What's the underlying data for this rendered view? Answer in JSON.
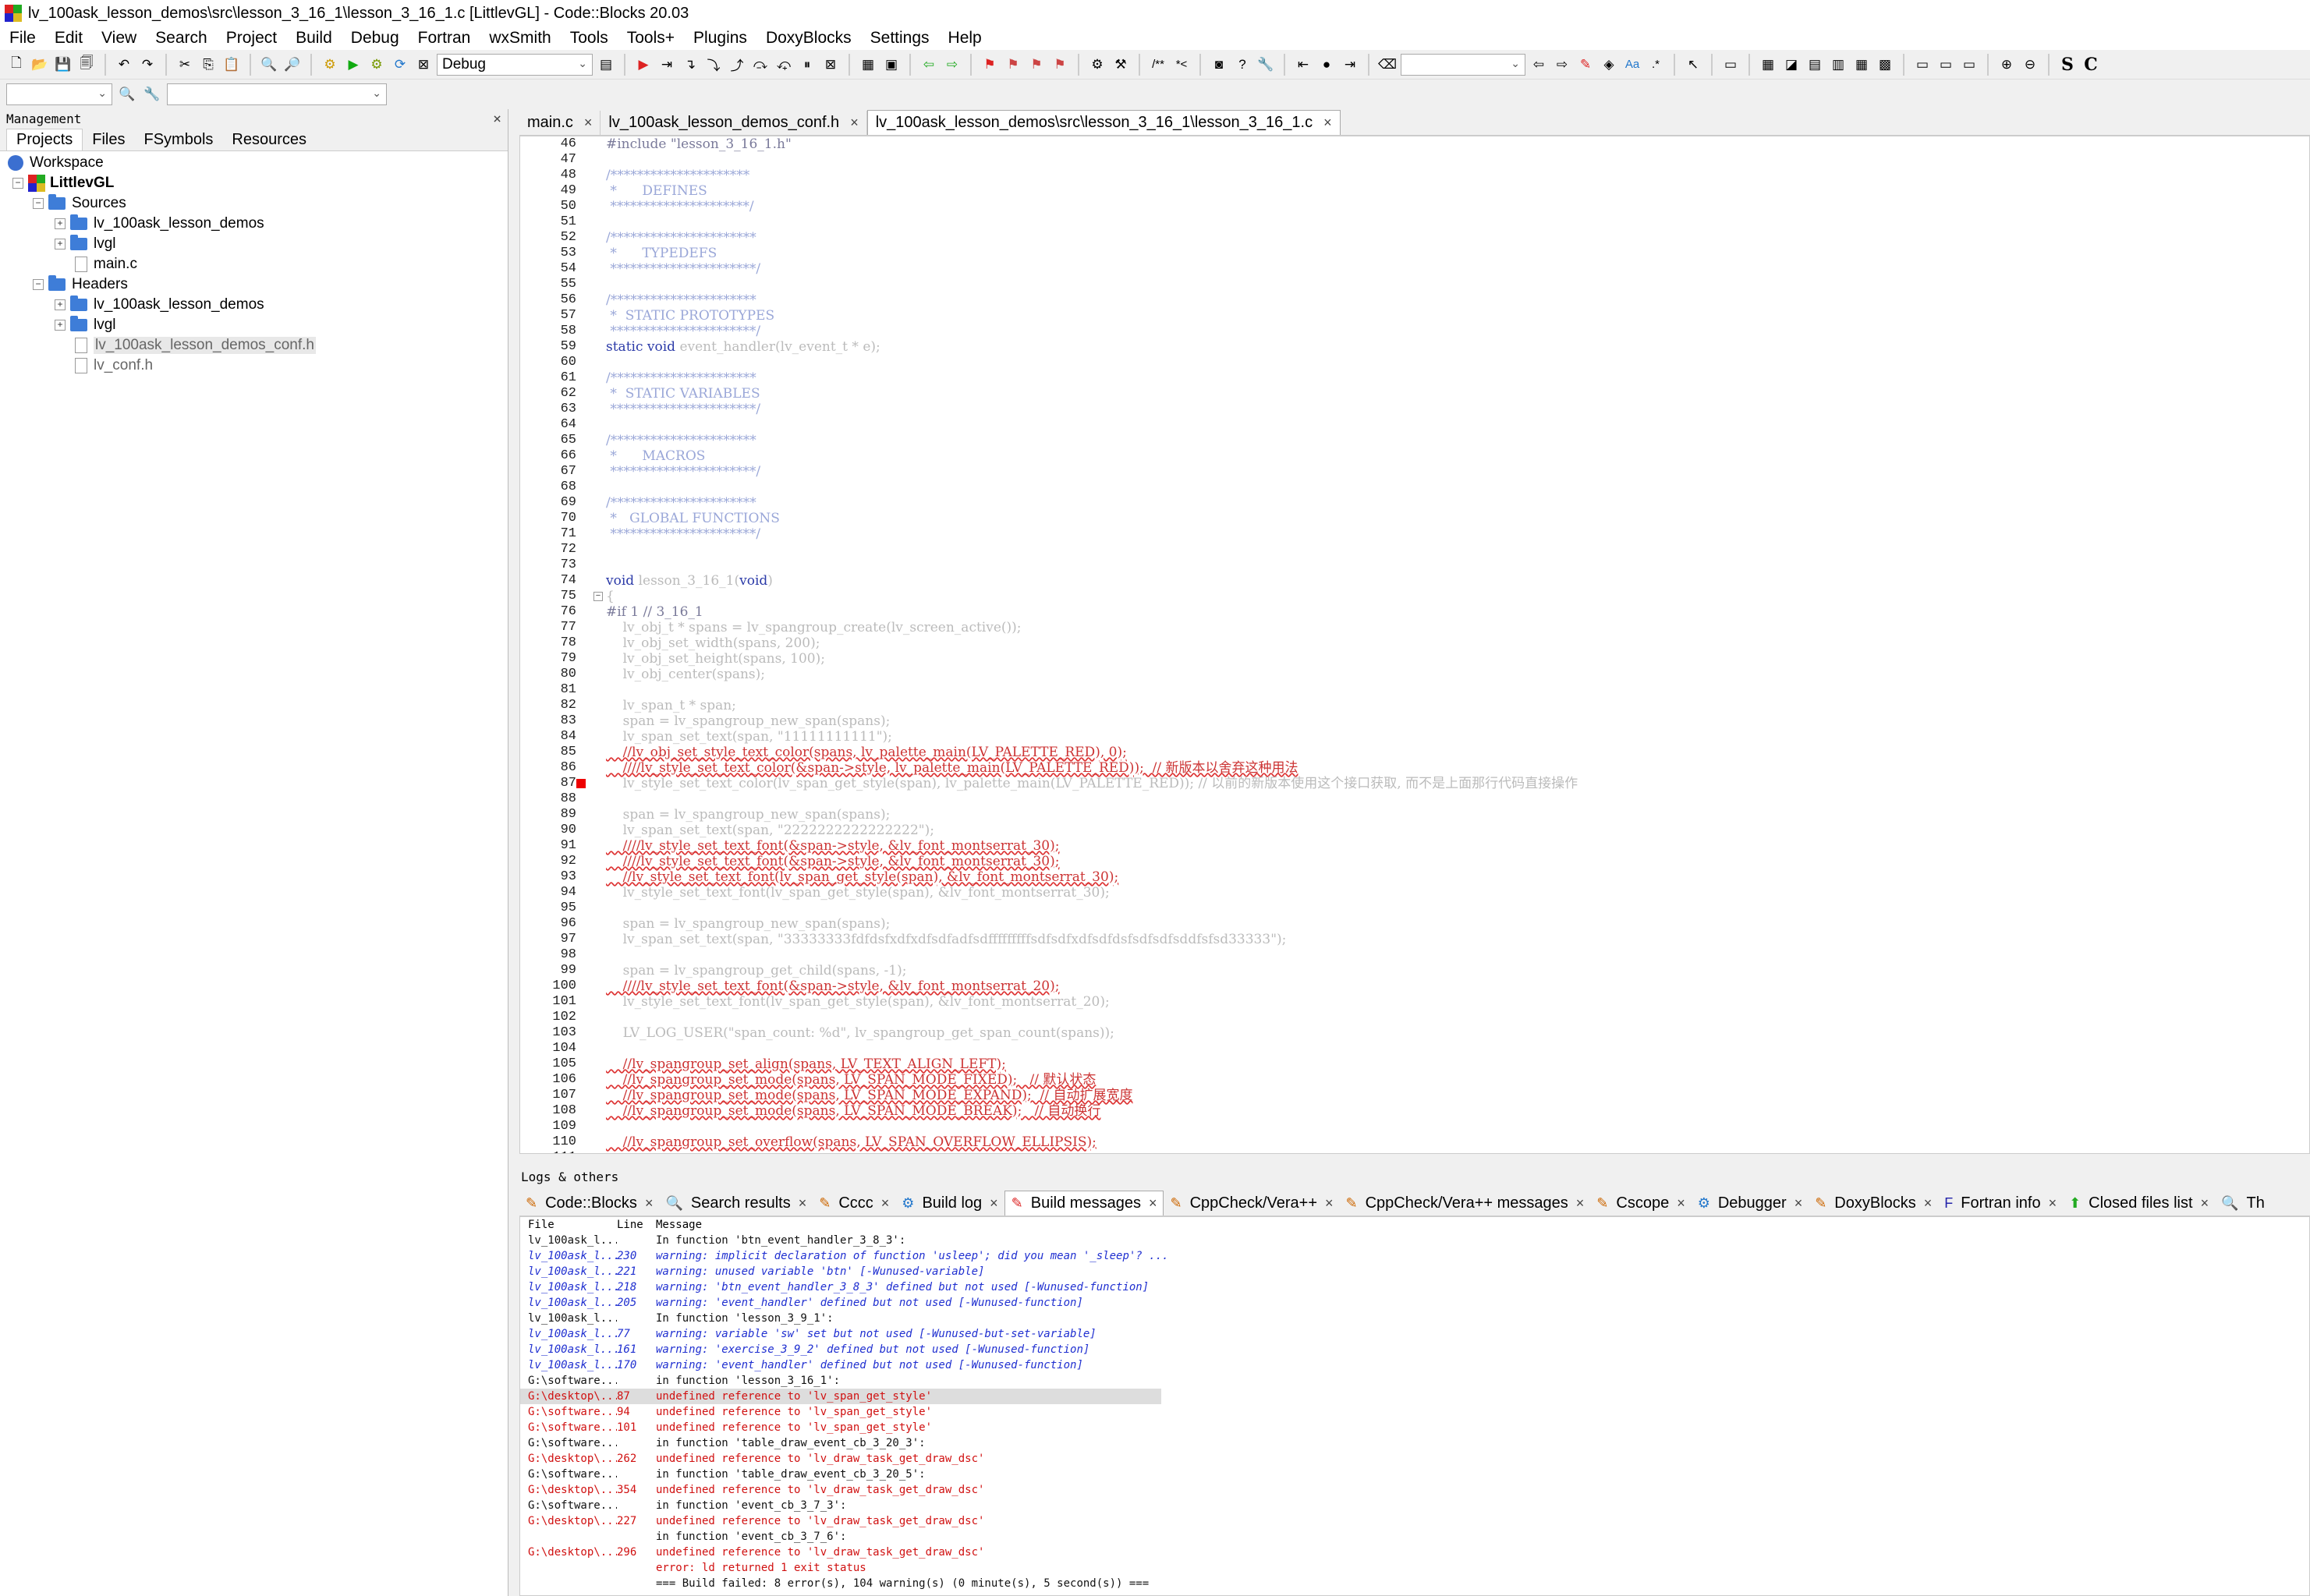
{
  "window": {
    "title": "lv_100ask_lesson_demos\\src\\lesson_3_16_1\\lesson_3_16_1.c [LittlevGL] - Code::Blocks 20.03"
  },
  "menu": [
    "File",
    "Edit",
    "View",
    "Search",
    "Project",
    "Build",
    "Debug",
    "Fortran",
    "wxSmith",
    "Tools",
    "Tools+",
    "Plugins",
    "DoxyBlocks",
    "Settings",
    "Help"
  ],
  "toolbar": {
    "build_target": "Debug",
    "search_value": ""
  },
  "management": {
    "title": "Management",
    "tabs": [
      "Projects",
      "Files",
      "FSymbols",
      "Resources"
    ],
    "tree": {
      "workspace": "Workspace",
      "project": "LittlevGL",
      "sources": "Sources",
      "src_items": [
        "lv_100ask_lesson_demos",
        "lvgl",
        "main.c"
      ],
      "headers": "Headers",
      "hdr_items": [
        "lv_100ask_lesson_demos",
        "lvgl",
        "lv_100ask_lesson_demos_conf.h",
        "lv_conf.h"
      ]
    }
  },
  "editor": {
    "tabs": [
      "main.c",
      "lv_100ask_lesson_demos_conf.h",
      "lv_100ask_lesson_demos\\src\\lesson_3_16_1\\lesson_3_16_1.c"
    ],
    "first_line": 46,
    "lines": [
      "#include \"lesson_3_16_1.h\"",
      "",
      "/*********************",
      " *      DEFINES",
      " *********************/",
      "",
      "/**********************",
      " *      TYPEDEFS",
      " **********************/",
      "",
      "/**********************",
      " *  STATIC PROTOTYPES",
      " **********************/",
      "static void event_handler(lv_event_t * e);",
      "",
      "/**********************",
      " *  STATIC VARIABLES",
      " **********************/",
      "",
      "/**********************",
      " *      MACROS",
      " **********************/",
      "",
      "/**********************",
      " *   GLOBAL FUNCTIONS",
      " **********************/",
      "",
      "",
      "void lesson_3_16_1(void)",
      "{",
      "#if 1 // 3_16_1",
      "    lv_obj_t * spans = lv_spangroup_create(lv_screen_active());",
      "    lv_obj_set_width(spans, 200);",
      "    lv_obj_set_height(spans, 100);",
      "    lv_obj_center(spans);",
      "",
      "    lv_span_t * span;",
      "    span = lv_spangroup_new_span(spans);",
      "    lv_span_set_text(span, \"11111111111\");",
      "    //lv_obj_set_style_text_color(spans, lv_palette_main(LV_PALETTE_RED), 0);",
      "    ////lv_style_set_text_color(&span->style, lv_palette_main(LV_PALETTE_RED));  // 新版本以舍弃这种用法",
      "    lv_style_set_text_color(lv_span_get_style(span), lv_palette_main(LV_PALETTE_RED)); // 以前的新版本使用这个接口获取, 而不是上面那行代码直接操作",
      "",
      "    span = lv_spangroup_new_span(spans);",
      "    lv_span_set_text(span, \"2222222222222222\");",
      "    ////lv_style_set_text_font(&span->style, &lv_font_montserrat_30);",
      "    ////lv_style_set_text_font(&span->style, &lv_font_montserrat_30);",
      "    //lv_style_set_text_font(lv_span_get_style(span), &lv_font_montserrat_30);",
      "    lv_style_set_text_font(lv_span_get_style(span), &lv_font_montserrat_30);",
      "",
      "    span = lv_spangroup_new_span(spans);",
      "    lv_span_set_text(span, \"33333333fdfdsfxdfxdfsdfadfsdfffffffffsdfsdfxdfsdfdsfsdfsdfsddfsfsd33333\");",
      "",
      "    span = lv_spangroup_get_child(spans, -1);",
      "    ////lv_style_set_text_font(&span->style, &lv_font_montserrat_20);",
      "    lv_style_set_text_font(lv_span_get_style(span), &lv_font_montserrat_20);",
      "",
      "    LV_LOG_USER(\"span_count: %d\", lv_spangroup_get_span_count(spans));",
      "",
      "    //lv_spangroup_set_align(spans, LV_TEXT_ALIGN_LEFT);",
      "    //lv_spangroup_set_mode(spans, LV_SPAN_MODE_FIXED);   // 默认状态",
      "    //lv_spangroup_set_mode(spans, LV_SPAN_MODE_EXPAND);  // 自动扩展宽度",
      "    //lv_spangroup_set_mode(spans, LV_SPAN_MODE_BREAK);   // 自动换行",
      "",
      "    //lv_spangroup_set_overflow(spans, LV_SPAN_OVERFLOW_ELLIPSIS);",
      ""
    ]
  },
  "logs": {
    "title": "Logs & others",
    "tabs": [
      "Code::Blocks",
      "Search results",
      "Cccc",
      "Build log",
      "Build messages",
      "CppCheck/Vera++",
      "CppCheck/Vera++ messages",
      "Cscope",
      "Debugger",
      "DoxyBlocks",
      "Fortran info",
      "Closed files list",
      "Th"
    ],
    "columns": [
      "File",
      "Line",
      "Message"
    ],
    "rows": [
      {
        "file": "lv_100ask_l...",
        "line": "",
        "msg": "In function 'btn_event_handler_3_8_3':",
        "kind": "black"
      },
      {
        "file": "lv_100ask_l...",
        "line": "230",
        "msg": "warning: implicit declaration of function 'usleep'; did you mean '_sleep'? ...",
        "kind": "blue"
      },
      {
        "file": "lv_100ask_l...",
        "line": "221",
        "msg": "warning: unused variable 'btn' [-Wunused-variable]",
        "kind": "blue"
      },
      {
        "file": "lv_100ask_l...",
        "line": "218",
        "msg": "warning: 'btn_event_handler_3_8_3' defined but not used [-Wunused-function]",
        "kind": "blue"
      },
      {
        "file": "lv_100ask_l...",
        "line": "205",
        "msg": "warning: 'event_handler' defined but not used [-Wunused-function]",
        "kind": "blue"
      },
      {
        "file": "lv_100ask_l...",
        "line": "",
        "msg": "In function 'lesson_3_9_1':",
        "kind": "black"
      },
      {
        "file": "lv_100ask_l...",
        "line": "77",
        "msg": "warning: variable 'sw' set but not used [-Wunused-but-set-variable]",
        "kind": "blue"
      },
      {
        "file": "lv_100ask_l...",
        "line": "161",
        "msg": "warning: 'exercise_3_9_2' defined but not used [-Wunused-function]",
        "kind": "blue"
      },
      {
        "file": "lv_100ask_l...",
        "line": "170",
        "msg": "warning: 'event_handler' defined but not used [-Wunused-function]",
        "kind": "blue"
      },
      {
        "file": "G:\\software...",
        "line": "",
        "msg": "in function 'lesson_3_16_1':",
        "kind": "black"
      },
      {
        "file": "G:\\desktop\\...",
        "line": "87",
        "msg": "undefined reference to 'lv_span_get_style'",
        "kind": "red",
        "selected": true
      },
      {
        "file": "G:\\software...",
        "line": "94",
        "msg": "undefined reference to 'lv_span_get_style'",
        "kind": "red"
      },
      {
        "file": "G:\\software...",
        "line": "101",
        "msg": "undefined reference to 'lv_span_get_style'",
        "kind": "red"
      },
      {
        "file": "G:\\software...",
        "line": "",
        "msg": "in function 'table_draw_event_cb_3_20_3':",
        "kind": "black"
      },
      {
        "file": "G:\\desktop\\...",
        "line": "262",
        "msg": "undefined reference to 'lv_draw_task_get_draw_dsc'",
        "kind": "red"
      },
      {
        "file": "G:\\software...",
        "line": "",
        "msg": "in function 'table_draw_event_cb_3_20_5':",
        "kind": "black"
      },
      {
        "file": "G:\\desktop\\...",
        "line": "354",
        "msg": "undefined reference to 'lv_draw_task_get_draw_dsc'",
        "kind": "red"
      },
      {
        "file": "G:\\software...",
        "line": "",
        "msg": "in function 'event_cb_3_7_3':",
        "kind": "black"
      },
      {
        "file": "G:\\desktop\\...",
        "line": "227",
        "msg": "undefined reference to 'lv_draw_task_get_draw_dsc'",
        "kind": "red"
      },
      {
        "file": "",
        "line": "",
        "msg": "in function 'event_cb_3_7_6':",
        "kind": "black"
      },
      {
        "file": "G:\\desktop\\...",
        "line": "296",
        "msg": "undefined reference to 'lv_draw_task_get_draw_dsc'",
        "kind": "red"
      },
      {
        "file": "",
        "line": "",
        "msg": "error: ld returned 1 exit status",
        "kind": "red"
      },
      {
        "file": "",
        "line": "",
        "msg": "=== Build failed: 8 error(s), 104 warning(s) (0 minute(s), 5 second(s)) ===",
        "kind": "black"
      }
    ]
  }
}
